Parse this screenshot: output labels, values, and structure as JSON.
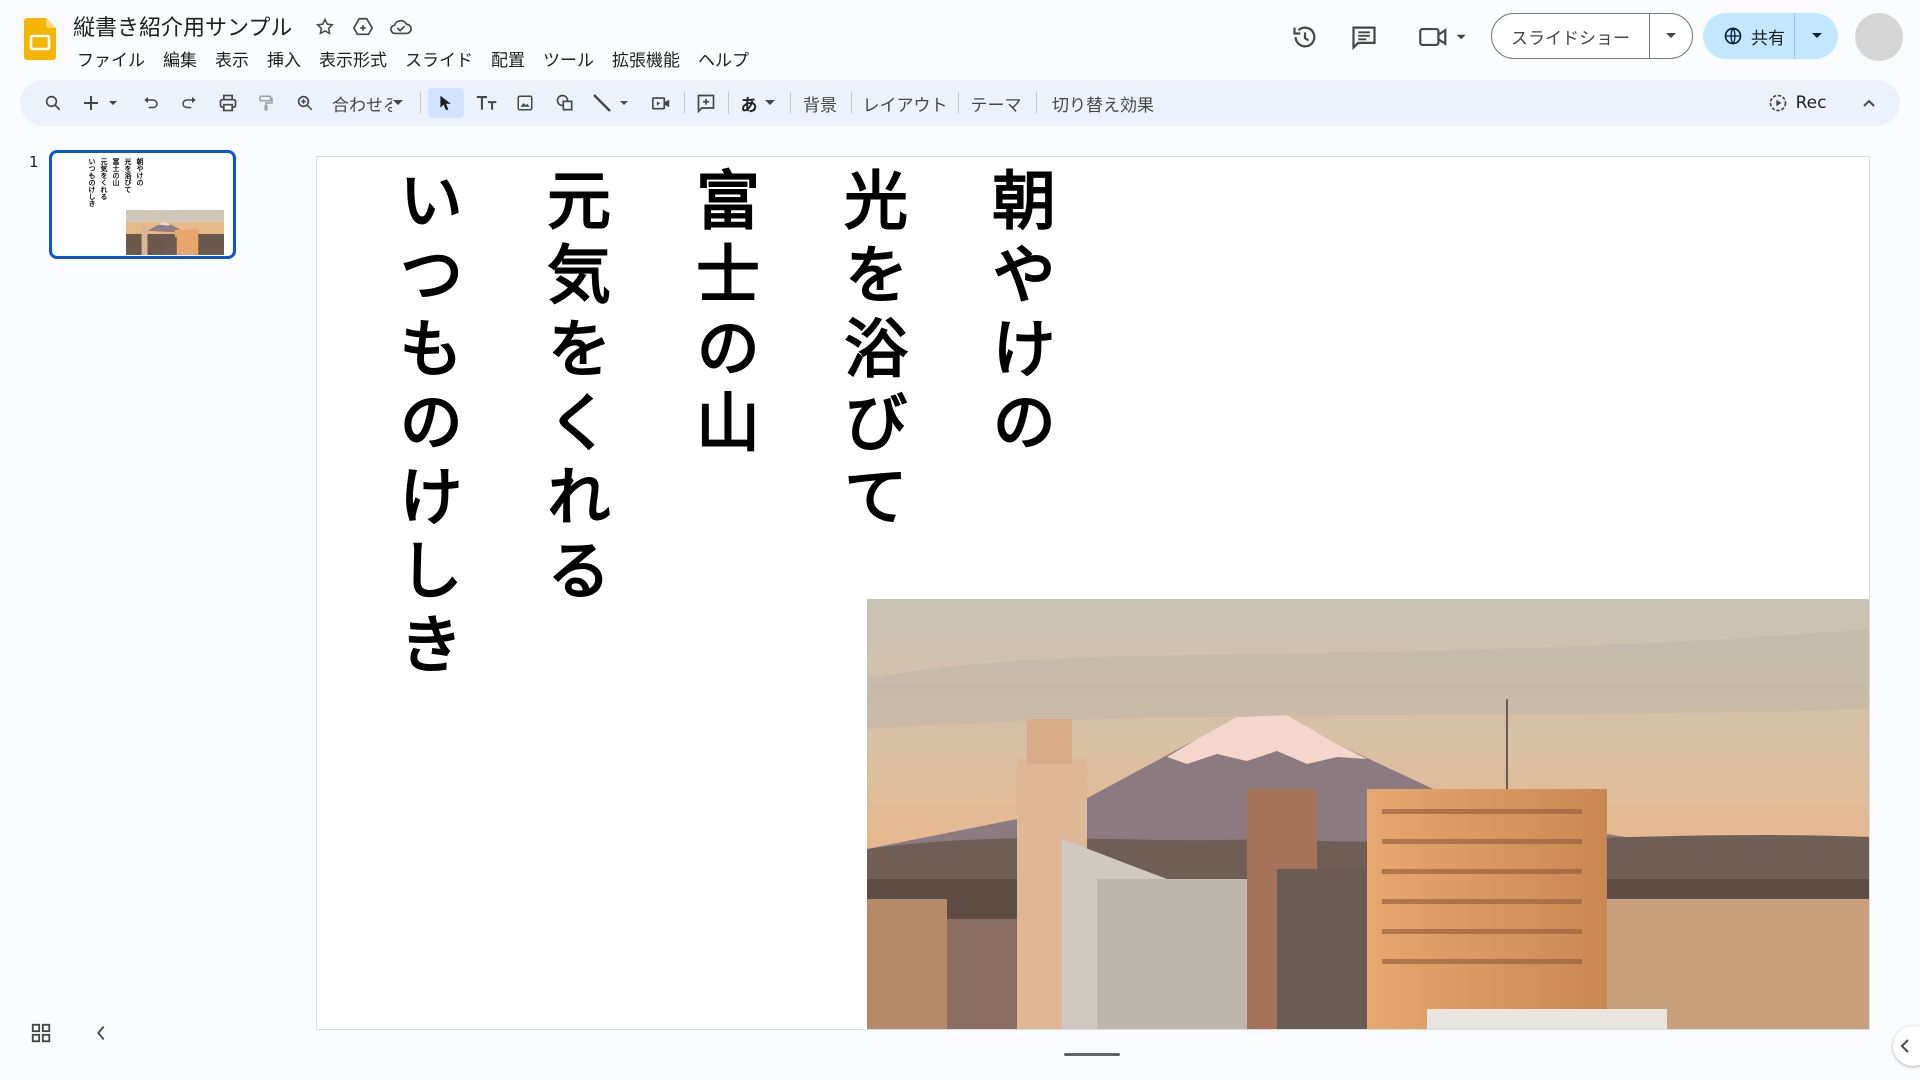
{
  "app": {
    "doc_title": "縦書き紹介用サンプル",
    "brand_color": "#f4b400",
    "accent_color": "#0b57d0"
  },
  "menu": [
    "ファイル",
    "編集",
    "表示",
    "挿入",
    "表示形式",
    "スライド",
    "配置",
    "ツール",
    "拡張機能",
    "ヘルプ"
  ],
  "header": {
    "slideshow_label": "スライドショー",
    "share_label": "共有",
    "icons": [
      "history-icon",
      "comment-icon",
      "meet-icon"
    ]
  },
  "toolbar": {
    "zoom_label": "合わせる",
    "input_tool_label": "あ",
    "background_label": "背景",
    "layout_label": "レイアウト",
    "theme_label": "テーマ",
    "transition_label": "切り替え効果",
    "rec_label": "Rec"
  },
  "filmstrip": {
    "slides": [
      {
        "number": "1"
      }
    ]
  },
  "slide": {
    "verse_lines": [
      "朝やけの",
      "光を浴びて",
      "富士の山",
      "元気をくれる",
      "いつものけしき"
    ]
  }
}
